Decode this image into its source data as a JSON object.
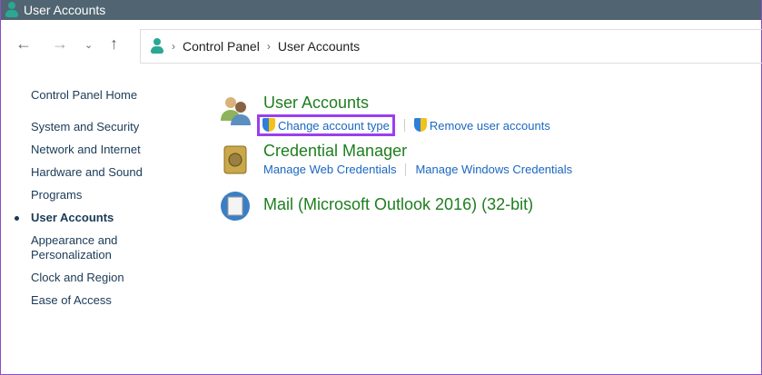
{
  "window": {
    "title": "User Accounts"
  },
  "breadcrumb": [
    "Control Panel",
    "User Accounts"
  ],
  "sidebar": {
    "items": [
      {
        "label": "Control Panel Home"
      },
      {
        "label": "System and Security"
      },
      {
        "label": "Network and Internet"
      },
      {
        "label": "Hardware and Sound"
      },
      {
        "label": "Programs"
      },
      {
        "label": "User Accounts",
        "active": true
      },
      {
        "label": "Appearance and Personalization"
      },
      {
        "label": "Clock and Region"
      },
      {
        "label": "Ease of Access"
      }
    ]
  },
  "main": {
    "user_accounts": {
      "title": "User Accounts",
      "links": [
        "Change account type",
        "Remove user accounts"
      ]
    },
    "credential_manager": {
      "title": "Credential Manager",
      "links": [
        "Manage Web Credentials",
        "Manage Windows Credentials"
      ]
    },
    "mail": {
      "title": "Mail (Microsoft Outlook 2016) (32-bit)"
    }
  },
  "colors": {
    "highlight": "#9a3ff0",
    "titlebar": "#506571",
    "heading": "#1e7e1e",
    "link": "#1a67c0"
  }
}
